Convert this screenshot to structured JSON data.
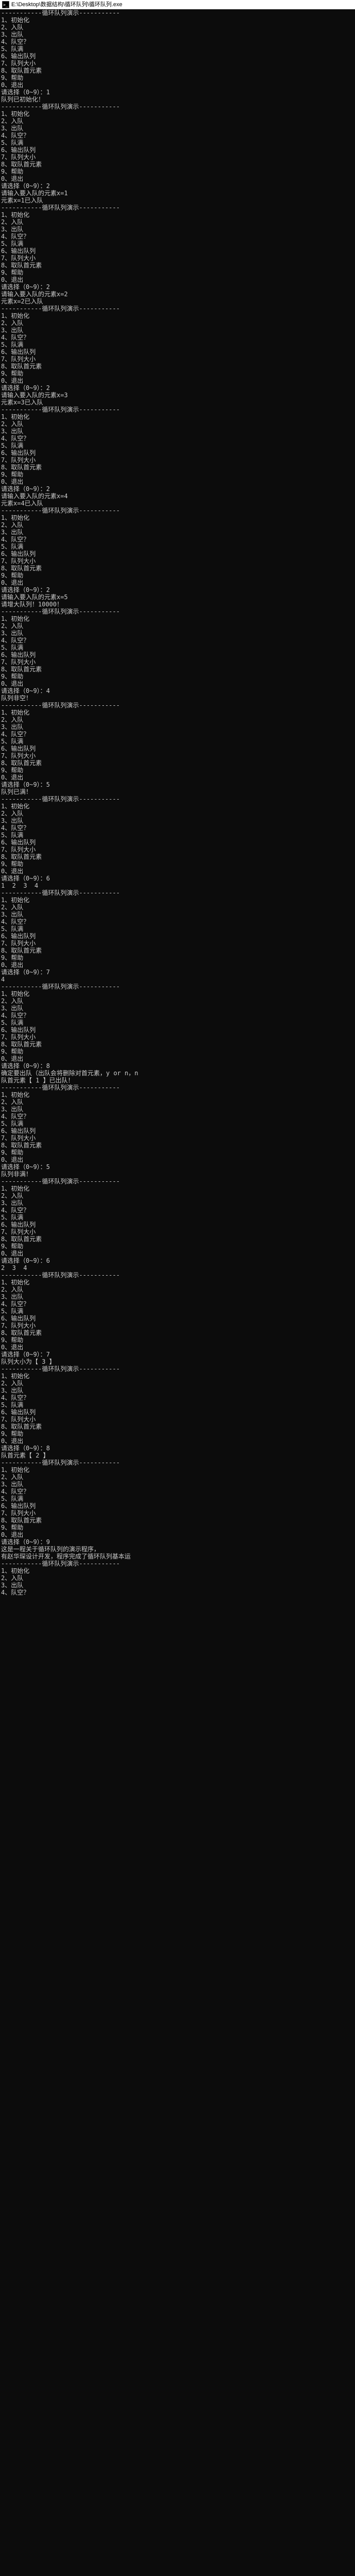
{
  "window": {
    "title": "E:\\Desktop\\数据结构\\循环队列\\循环队列.exe",
    "icon_name": "console-icon"
  },
  "menu": {
    "items": [
      "1、初始化",
      "2、入队",
      "3、出队",
      "4、队空？",
      "5、队满",
      "6、输出队列",
      "7、队列大小",
      "8、取队首元素",
      "9、帮助",
      "0、退出"
    ],
    "header": "-----------循环队列演示-----------",
    "prompt": "请选择（0~9）："
  },
  "interactions": [
    {
      "type": "menu"
    },
    {
      "type": "choice",
      "value": "1"
    },
    {
      "type": "text",
      "value": "队列已初始化！"
    },
    {
      "type": "menu"
    },
    {
      "type": "choice",
      "value": "2"
    },
    {
      "type": "prompt_input",
      "prompt": "请输入要入队的元素x=",
      "value": "1"
    },
    {
      "type": "text",
      "value": "元素x=1已入队"
    },
    {
      "type": "menu"
    },
    {
      "type": "choice",
      "value": "2"
    },
    {
      "type": "prompt_input",
      "prompt": "请输入要入队的元素x=",
      "value": "2"
    },
    {
      "type": "text",
      "value": "元素x=2已入队"
    },
    {
      "type": "menu"
    },
    {
      "type": "choice",
      "value": "2"
    },
    {
      "type": "prompt_input",
      "prompt": "请输入要入队的元素x=",
      "value": "3"
    },
    {
      "type": "text",
      "value": "元素x=3已入队"
    },
    {
      "type": "menu"
    },
    {
      "type": "choice",
      "value": "2"
    },
    {
      "type": "prompt_input",
      "prompt": "请输入要入队的元素x=",
      "value": "4"
    },
    {
      "type": "text",
      "value": "元素x=4已入队"
    },
    {
      "type": "menu"
    },
    {
      "type": "choice",
      "value": "2"
    },
    {
      "type": "prompt_input",
      "prompt": "请输入要入队的元素x=",
      "value": "5"
    },
    {
      "type": "text",
      "value": "请增大队列！10000！"
    },
    {
      "type": "menu"
    },
    {
      "type": "choice",
      "value": "4"
    },
    {
      "type": "text",
      "value": "队列非空！"
    },
    {
      "type": "menu"
    },
    {
      "type": "choice",
      "value": "5"
    },
    {
      "type": "text",
      "value": "队列已满！"
    },
    {
      "type": "menu"
    },
    {
      "type": "choice",
      "value": "6"
    },
    {
      "type": "text",
      "value": "1  2  3  4"
    },
    {
      "type": "menu"
    },
    {
      "type": "choice",
      "value": "7"
    },
    {
      "type": "text",
      "value": "4"
    },
    {
      "type": "menu"
    },
    {
      "type": "choice",
      "value": "8"
    },
    {
      "type": "text",
      "value": "确定要出队（出队会将删除对首元素，y or n，n"
    },
    {
      "type": "text",
      "value": "队首元素【 1 】已出队！"
    },
    {
      "type": "menu"
    },
    {
      "type": "choice",
      "value": "5"
    },
    {
      "type": "text",
      "value": "队列非满！"
    },
    {
      "type": "menu"
    },
    {
      "type": "choice",
      "value": "6"
    },
    {
      "type": "text",
      "value": "2  3  4"
    },
    {
      "type": "menu"
    },
    {
      "type": "choice",
      "value": "7"
    },
    {
      "type": "text",
      "value": "队列大小为【 3 】"
    },
    {
      "type": "menu"
    },
    {
      "type": "choice",
      "value": "8"
    },
    {
      "type": "text",
      "value": "队首元素【 2 】"
    },
    {
      "type": "menu"
    },
    {
      "type": "choice",
      "value": "9"
    },
    {
      "type": "text",
      "value": "这是一程关于循环队列的演示程序，"
    },
    {
      "type": "text",
      "value": "有赵华琛设计开发，程序完成了循环队列基本运"
    },
    {
      "type": "menu_partial",
      "items": [
        "1、初始化",
        "2、入队",
        "3、出队",
        "4、队空？"
      ]
    }
  ]
}
